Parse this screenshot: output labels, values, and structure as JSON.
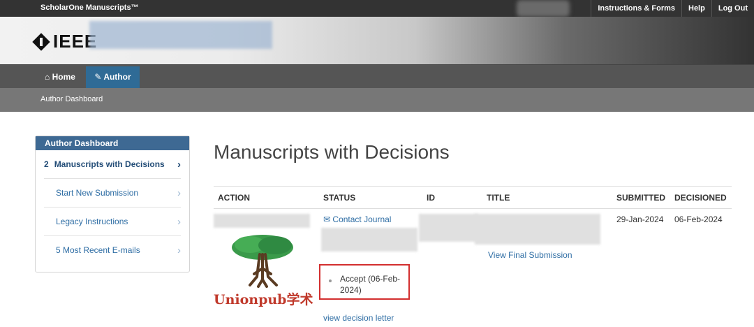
{
  "topbar": {
    "brand": "ScholarOne Manuscripts™",
    "links": [
      "Instructions & Forms",
      "Help",
      "Log Out"
    ]
  },
  "banner": {
    "logo_text": "IEEE"
  },
  "nav": {
    "tabs": [
      {
        "label": "Home",
        "icon": "home-icon"
      },
      {
        "label": "Author",
        "icon": "pencil-icon",
        "active": true
      }
    ]
  },
  "subnav": {
    "label": "Author Dashboard"
  },
  "sidebar": {
    "heading": "Author Dashboard",
    "items": [
      {
        "count": "2",
        "label": "Manuscripts with Decisions",
        "active": true
      },
      {
        "count": "",
        "label": "Start New Submission"
      },
      {
        "count": "",
        "label": "Legacy Instructions"
      },
      {
        "count": "",
        "label": "5 Most Recent E-mails"
      }
    ]
  },
  "main": {
    "title": "Manuscripts with Decisions",
    "columns": [
      "ACTION",
      "STATUS",
      "ID",
      "TITLE",
      "SUBMITTED",
      "DECISIONED"
    ],
    "row": {
      "contact_label": "Contact Journal",
      "status": "Accept (06-Feb-2024)",
      "decision_letter_link": "view decision letter",
      "view_final_link": "View Final Submission",
      "submitted": "29-Jan-2024",
      "decisioned": "06-Feb-2024"
    }
  },
  "watermark": {
    "text": "Unionpub学术"
  },
  "colors": {
    "accent": "#2f6b96",
    "highlight_border": "#d32f2f"
  }
}
